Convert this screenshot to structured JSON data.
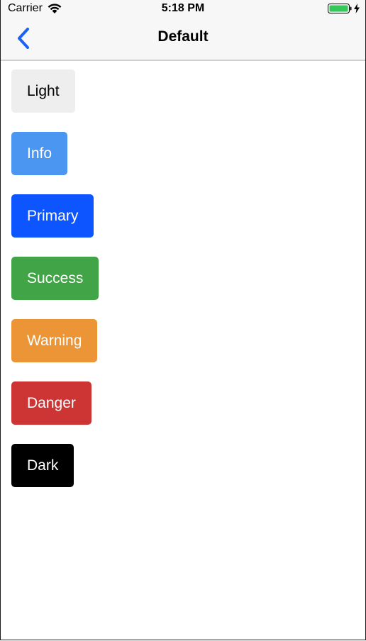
{
  "status_bar": {
    "carrier": "Carrier",
    "time": "5:18 PM",
    "wifi_icon": "wifi-icon",
    "battery_icon": "battery-charging-icon"
  },
  "nav": {
    "title": "Default",
    "back_icon": "chevron-left-icon"
  },
  "buttons": [
    {
      "label": "Light",
      "bg": "#eeeeee",
      "fg": "#000000"
    },
    {
      "label": "Info",
      "bg": "#4a96f0",
      "fg": "#ffffff"
    },
    {
      "label": "Primary",
      "bg": "#0d55ff",
      "fg": "#ffffff"
    },
    {
      "label": "Success",
      "bg": "#41a547",
      "fg": "#ffffff"
    },
    {
      "label": "Warning",
      "bg": "#eb9536",
      "fg": "#ffffff"
    },
    {
      "label": "Danger",
      "bg": "#cd3535",
      "fg": "#ffffff"
    },
    {
      "label": "Dark",
      "bg": "#000000",
      "fg": "#ffffff"
    }
  ]
}
